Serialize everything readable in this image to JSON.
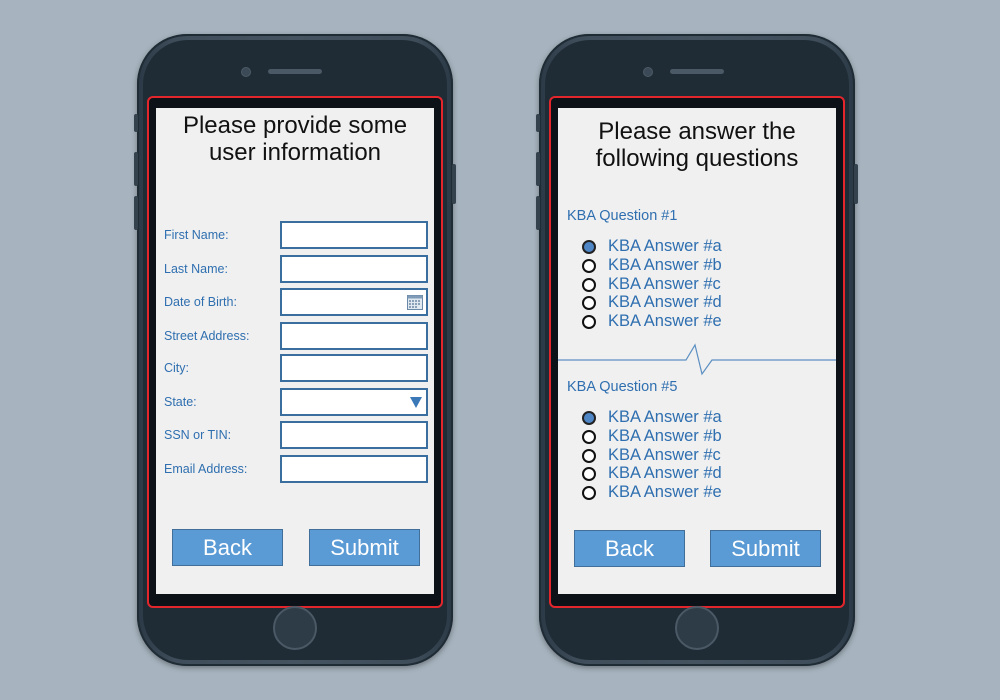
{
  "form_screen": {
    "title_line1": "Please provide some",
    "title_line2": "user information",
    "fields": [
      {
        "label": "First Name:",
        "value": ""
      },
      {
        "label": "Last Name:",
        "value": ""
      },
      {
        "label": "Date of Birth:",
        "value": "",
        "icon": "calendar-icon"
      },
      {
        "label": "Street Address:",
        "value": ""
      },
      {
        "label": "City:",
        "value": ""
      },
      {
        "label": "State:",
        "value": "",
        "icon": "chevron-down-icon"
      },
      {
        "label": "SSN or TIN:",
        "value": ""
      },
      {
        "label": "Email Address:",
        "value": ""
      }
    ],
    "back_label": "Back",
    "submit_label": "Submit"
  },
  "quiz_screen": {
    "title_line1": "Please answer the",
    "title_line2": "following questions",
    "questions": [
      {
        "label": "KBA Question #1",
        "answers": [
          "KBA Answer #a",
          "KBA Answer #b",
          "KBA Answer #c",
          "KBA Answer #d",
          "KBA Answer #e"
        ],
        "selected_index": 0
      },
      {
        "label": "KBA Question #5",
        "answers": [
          "KBA Answer #a",
          "KBA Answer #b",
          "KBA Answer #c",
          "KBA Answer #d",
          "KBA Answer #e"
        ],
        "selected_index": 0
      }
    ],
    "back_label": "Back",
    "submit_label": "Submit"
  },
  "colors": {
    "background": "#a7b4bf",
    "phone_body": "#3e4d59",
    "screen_border": "#e3262c",
    "label_blue": "#2f6fb0",
    "button_blue": "#5b9bd5"
  }
}
